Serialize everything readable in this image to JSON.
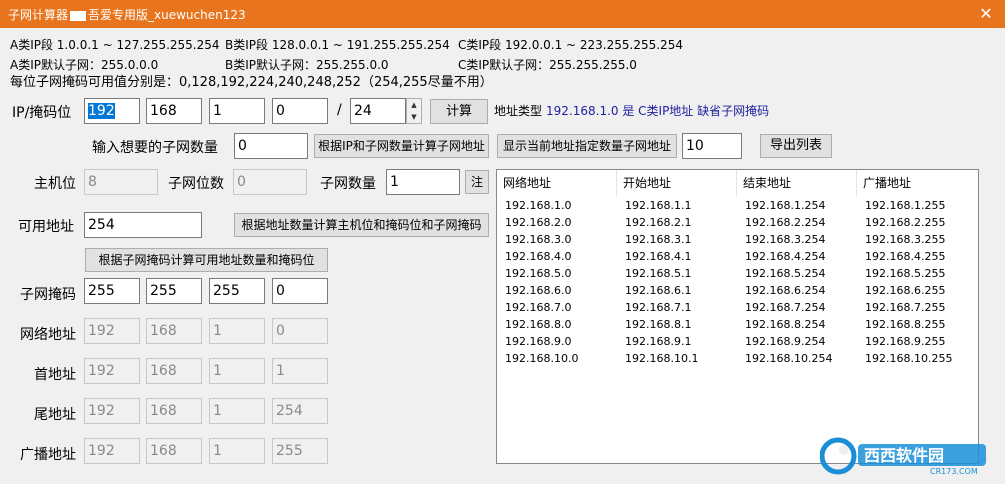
{
  "window": {
    "title_prefix": "子网计算器",
    "title_suffix": "吾爱专用版_xuewuchen123",
    "close_glyph": "✕"
  },
  "info": {
    "class_a_range": "A类IP段 1.0.0.1 ~ 127.255.255.254",
    "class_b_range": "B类IP段 128.0.0.1 ~ 191.255.255.254",
    "class_c_range": "C类IP段 192.0.0.1 ~ 223.255.255.254",
    "class_a_mask": "A类IP默认子网：255.0.0.0",
    "class_b_mask": "B类IP默认子网：255.255.0.0",
    "class_c_mask": "C类IP默认子网：255.255.255.0",
    "mask_values": "每位子网掩码可用值分别是：0,128,192,224,240,248,252（254,255尽量不用）"
  },
  "ip_row": {
    "label": "IP/掩码位",
    "octets": [
      "192",
      "168",
      "1",
      "0"
    ],
    "slash": "/",
    "prefix": "24",
    "calc_button": "计算",
    "type_label": "地址类型",
    "type_value": "192.168.1.0 是 C类IP地址 缺省子网掩码"
  },
  "subnet_count_row": {
    "label": "输入想要的子网数量",
    "value": "0",
    "calc_by_ip_button": "根据IP和子网数量计算子网地址",
    "show_button": "显示当前地址指定数量子网地址",
    "show_count": "10",
    "export_button": "导出列表"
  },
  "host_row": {
    "host_bits_label": "主机位",
    "host_bits_value": "8",
    "subnet_bits_label": "子网位数",
    "subnet_bits_value": "0",
    "subnet_count_label": "子网数量",
    "subnet_count_value": "1",
    "note_button": "注"
  },
  "usable_row": {
    "label": "可用地址",
    "value": "254",
    "calc_button": "根据地址数量计算主机位和掩码位和子网掩码"
  },
  "mask_calc_button": "根据子网掩码计算可用地址数量和掩码位",
  "addr_rows": [
    {
      "label": "子网掩码",
      "octets": [
        "255",
        "255",
        "255",
        "0"
      ],
      "disabled": false
    },
    {
      "label": "网络地址",
      "octets": [
        "192",
        "168",
        "1",
        "0"
      ],
      "disabled": true
    },
    {
      "label": "首地址",
      "octets": [
        "192",
        "168",
        "1",
        "1"
      ],
      "disabled": true
    },
    {
      "label": "尾地址",
      "octets": [
        "192",
        "168",
        "1",
        "254"
      ],
      "disabled": true
    },
    {
      "label": "广播地址",
      "octets": [
        "192",
        "168",
        "1",
        "255"
      ],
      "disabled": true
    }
  ],
  "subnet_list": {
    "columns": [
      "网络地址",
      "开始地址",
      "结束地址",
      "广播地址"
    ],
    "rows": [
      [
        "192.168.1.0",
        "192.168.1.1",
        "192.168.1.254",
        "192.168.1.255"
      ],
      [
        "192.168.2.0",
        "192.168.2.1",
        "192.168.2.254",
        "192.168.2.255"
      ],
      [
        "192.168.3.0",
        "192.168.3.1",
        "192.168.3.254",
        "192.168.3.255"
      ],
      [
        "192.168.4.0",
        "192.168.4.1",
        "192.168.4.254",
        "192.168.4.255"
      ],
      [
        "192.168.5.0",
        "192.168.5.1",
        "192.168.5.254",
        "192.168.5.255"
      ],
      [
        "192.168.6.0",
        "192.168.6.1",
        "192.168.6.254",
        "192.168.6.255"
      ],
      [
        "192.168.7.0",
        "192.168.7.1",
        "192.168.7.254",
        "192.168.7.255"
      ],
      [
        "192.168.8.0",
        "192.168.8.1",
        "192.168.8.254",
        "192.168.8.255"
      ],
      [
        "192.168.9.0",
        "192.168.9.1",
        "192.168.9.254",
        "192.168.9.255"
      ],
      [
        "192.168.10.0",
        "192.168.10.1",
        "192.168.10.254",
        "192.168.10.255"
      ]
    ]
  },
  "watermark": {
    "brand": "西西软件园",
    "domain": "CR173.COM"
  },
  "colors": {
    "titlebar": "#e8751e",
    "selection": "#0078d7",
    "type_text": "#2020a0",
    "watermark": "#1a8fd8"
  }
}
